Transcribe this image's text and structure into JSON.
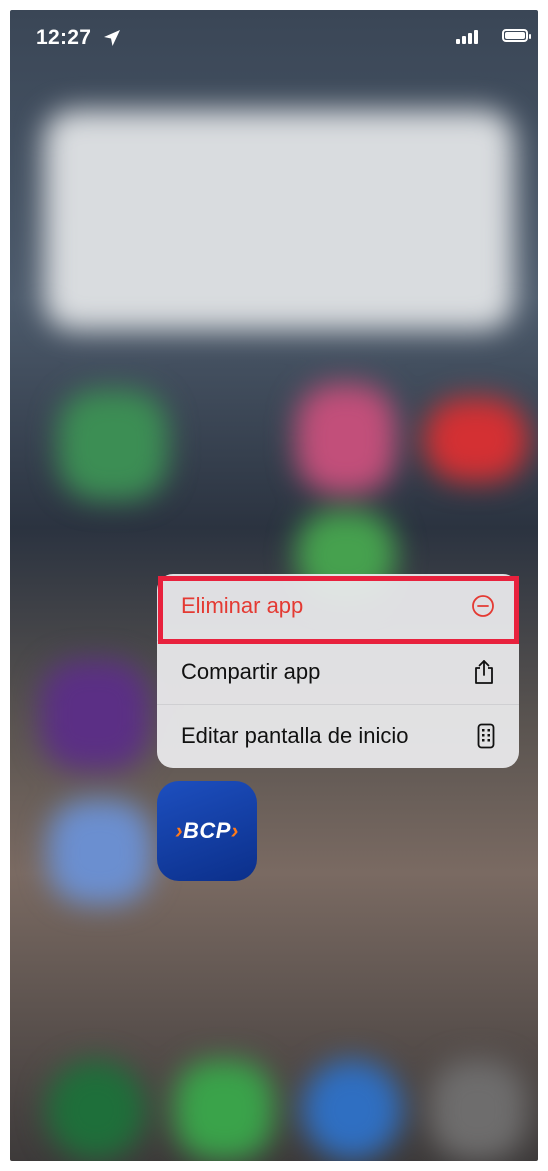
{
  "status_bar": {
    "time": "12:27"
  },
  "context_menu": {
    "items": [
      {
        "label": "Eliminar app",
        "icon": "minus-circle-icon",
        "destructive": true
      },
      {
        "label": "Compartir app",
        "icon": "share-icon",
        "destructive": false
      },
      {
        "label": "Editar pantalla de inicio",
        "icon": "phone-grid-icon",
        "destructive": false
      }
    ]
  },
  "app": {
    "logo_text": "BCP",
    "logo_prefix": "›",
    "logo_suffix": "›"
  },
  "colors": {
    "destructive": "#e43a33",
    "highlight": "#e8213d",
    "bcp_blue": "#0b2f8a",
    "bcp_orange": "#ff7a1a"
  }
}
